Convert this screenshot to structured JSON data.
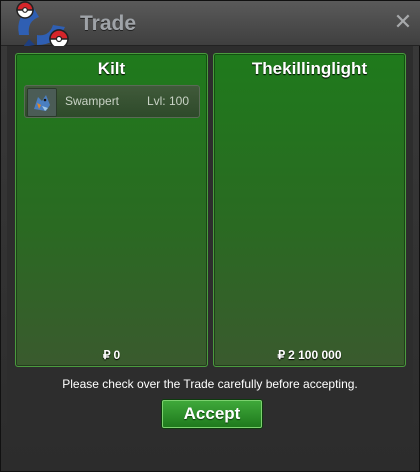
{
  "window": {
    "title": "Trade",
    "close_icon": "close-icon"
  },
  "trade": {
    "left": {
      "trader": "Kilt",
      "items": [
        {
          "name": "Swampert",
          "level": "Lvl: 100",
          "icon": "swampert-icon"
        }
      ],
      "currency_symbol": "₽",
      "money": "0"
    },
    "right": {
      "trader": "Thekillinglight",
      "items": [],
      "currency_symbol": "₽",
      "money": "2 100 000"
    },
    "notice": "Please check over the Trade carefully before accepting.",
    "accept_label": "Accept"
  },
  "colors": {
    "panel_green": "#1f7a1c",
    "accept_green": "#3fa83a"
  }
}
